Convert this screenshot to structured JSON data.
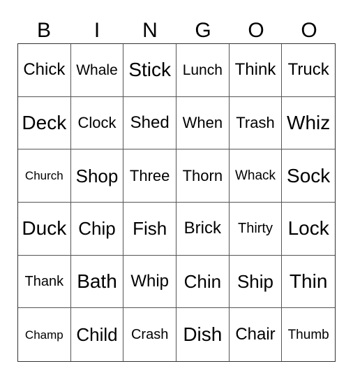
{
  "header": [
    "B",
    "I",
    "N",
    "G",
    "O",
    "O"
  ],
  "rows": [
    [
      "Chick",
      "Whale",
      "Stick",
      "Lunch",
      "Think",
      "Truck"
    ],
    [
      "Deck",
      "Clock",
      "Shed",
      "When",
      "Trash",
      "Whiz"
    ],
    [
      "Church",
      "Shop",
      "Three",
      "Thorn",
      "Whack",
      "Sock"
    ],
    [
      "Duck",
      "Chip",
      "Fish",
      "Brick",
      "Thirty",
      "Lock"
    ],
    [
      "Thank",
      "Bath",
      "Whip",
      "Chin",
      "Ship",
      "Thin"
    ],
    [
      "Champ",
      "Child",
      "Crash",
      "Dish",
      "Chair",
      "Thumb"
    ]
  ]
}
